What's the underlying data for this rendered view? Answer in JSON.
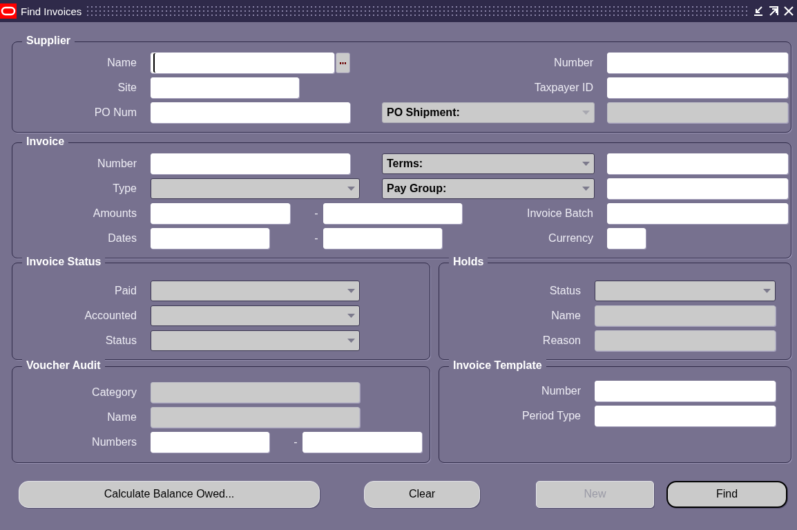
{
  "window": {
    "title": "Find Invoices"
  },
  "supplier": {
    "title": "Supplier",
    "name": {
      "label": "Name",
      "focused": true,
      "disabled": false
    },
    "site": {
      "label": "Site",
      "disabled": false
    },
    "po_num": {
      "label": "PO Num",
      "disabled": false
    },
    "number": {
      "label": "Number",
      "disabled": false
    },
    "taxpayer_id": {
      "label": "Taxpayer ID",
      "disabled": false
    },
    "po_shipment": {
      "option": "PO Shipment:",
      "disabled": true
    }
  },
  "invoice": {
    "title": "Invoice",
    "number": {
      "label": "Number",
      "disabled": false
    },
    "type": {
      "label": "Type",
      "disabled": false
    },
    "amounts": {
      "label": "Amounts",
      "separator": "-",
      "disabled": false
    },
    "dates": {
      "label": "Dates",
      "separator": "-",
      "disabled": false
    },
    "terms": {
      "option": "Terms:",
      "disabled": false
    },
    "pay_group": {
      "option": "Pay Group:",
      "disabled": false
    },
    "invoice_batch": {
      "label": "Invoice Batch",
      "disabled": false
    },
    "currency": {
      "label": "Currency",
      "disabled": false
    }
  },
  "invoice_status": {
    "title": "Invoice Status",
    "paid": {
      "label": "Paid",
      "disabled": false
    },
    "accounted": {
      "label": "Accounted",
      "disabled": false
    },
    "status": {
      "label": "Status",
      "disabled": false
    }
  },
  "holds": {
    "title": "Holds",
    "status": {
      "label": "Status",
      "disabled": false
    },
    "name": {
      "label": "Name",
      "disabled": true
    },
    "reason": {
      "label": "Reason",
      "disabled": true
    }
  },
  "voucher_audit": {
    "title": "Voucher Audit",
    "category": {
      "label": "Category",
      "disabled": true
    },
    "name": {
      "label": "Name",
      "disabled": true
    },
    "numbers": {
      "label": "Numbers",
      "separator": "-",
      "disabled": false
    }
  },
  "invoice_template": {
    "title": "Invoice Template",
    "number": {
      "label": "Number",
      "disabled": false
    },
    "period_type": {
      "label": "Period Type",
      "disabled": false
    }
  },
  "buttons": [
    {
      "label": "Calculate Balance Owed...",
      "disabled": false,
      "default": false
    },
    {
      "label": "Clear",
      "disabled": false,
      "default": false
    },
    {
      "label": "New",
      "disabled": true,
      "default": false
    },
    {
      "label": "Find",
      "disabled": false,
      "default": true
    }
  ]
}
